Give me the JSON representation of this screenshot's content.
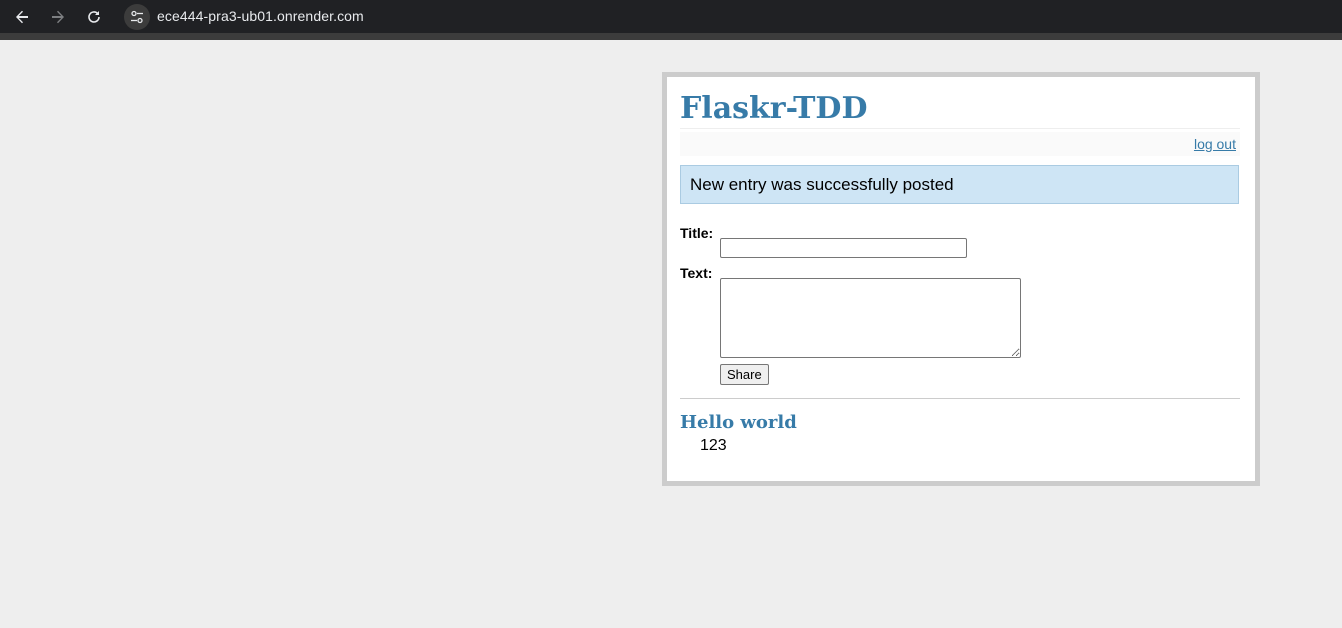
{
  "browser": {
    "url": "ece444-pra3-ub01.onrender.com",
    "back_icon": "arrow-left-icon",
    "forward_icon": "arrow-right-icon",
    "reload_icon": "reload-icon",
    "site_info_icon": "tune-icon"
  },
  "page": {
    "title": "Flaskr-TDD",
    "logout_label": "log out",
    "flash_message": "New entry was successfully posted",
    "form": {
      "title_label": "Title:",
      "title_value": "",
      "text_label": "Text:",
      "text_value": "",
      "submit_label": "Share"
    },
    "entries": [
      {
        "title": "Hello world",
        "text": "123"
      }
    ]
  },
  "colors": {
    "accent": "#377ba8",
    "flash_bg": "#cee5f5",
    "page_border": "#cccccc",
    "background": "#eeeeee"
  }
}
